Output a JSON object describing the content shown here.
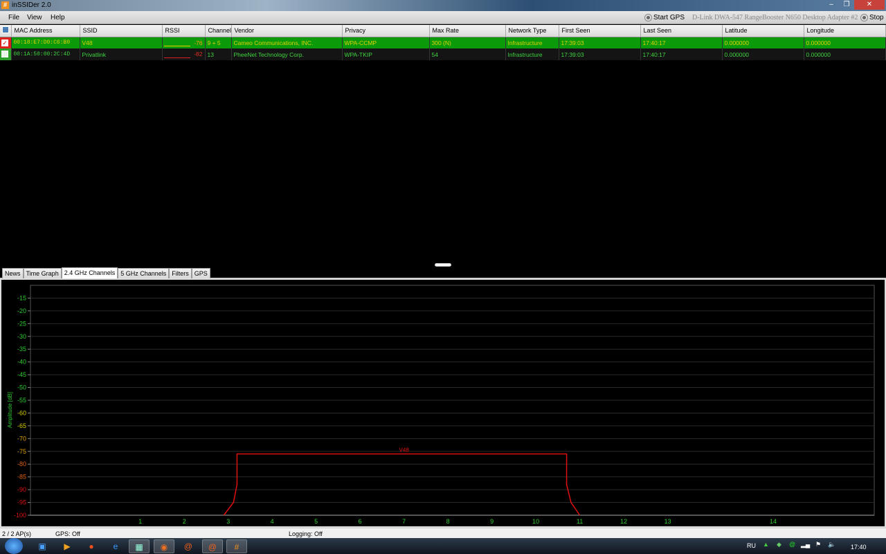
{
  "window": {
    "title": "inSSIDer 2.0",
    "app_icon": "#"
  },
  "menu": {
    "items": [
      "File",
      "View",
      "Help"
    ],
    "start_gps": "Start GPS",
    "adapter": "D-Link DWA-547 RangeBooster N650 Desktop Adapter #2",
    "stop": "Stop"
  },
  "table": {
    "columns": [
      "MAC Address",
      "SSID",
      "RSSI",
      "Channel",
      "Vendor",
      "Privacy",
      "Max Rate",
      "Network Type",
      "First Seen",
      "Last Seen",
      "Latitude",
      "Longitude"
    ],
    "rows": [
      {
        "checked": true,
        "mac": "00:18:E7:D0:C6:B0",
        "ssid": "V48",
        "rssi": "-76",
        "channel": "9 + 5",
        "vendor": "Cameo Communications, INC.",
        "privacy": "WPA-CCMP",
        "max_rate": "300 (N)",
        "network_type": "Infrastructure",
        "first_seen": "17:39:03",
        "last_seen": "17:40:17",
        "latitude": "0.000000",
        "longitude": "0.000000"
      },
      {
        "checked": false,
        "mac": "00:1A:50:00:2C:4D",
        "ssid": "Privatlink",
        "rssi": "-82",
        "channel": "13",
        "vendor": "PheeNet Technology Corp.",
        "privacy": "WPA-TKIP",
        "max_rate": "54",
        "network_type": "Infrastructure",
        "first_seen": "17:39:03",
        "last_seen": "17:40:17",
        "latitude": "0.000000",
        "longitude": "0.000000"
      }
    ]
  },
  "tabs": [
    "News",
    "Time Graph",
    "2.4 GHz Channels",
    "5 GHz Channels",
    "Filters",
    "GPS"
  ],
  "active_tab": "2.4 GHz Channels",
  "chart_data": {
    "type": "line",
    "title": "",
    "xlabel": "",
    "ylabel": "Amplitude [dB]",
    "xlim_mhz": [
      2399.5,
      2495.5
    ],
    "ylim": [
      -10,
      -100
    ],
    "x_ticks": [
      {
        "label": "1",
        "mhz": 2412
      },
      {
        "label": "2",
        "mhz": 2417
      },
      {
        "label": "3",
        "mhz": 2422
      },
      {
        "label": "4",
        "mhz": 2427
      },
      {
        "label": "5",
        "mhz": 2432
      },
      {
        "label": "6",
        "mhz": 2437
      },
      {
        "label": "7",
        "mhz": 2442
      },
      {
        "label": "8",
        "mhz": 2447
      },
      {
        "label": "9",
        "mhz": 2452
      },
      {
        "label": "10",
        "mhz": 2457
      },
      {
        "label": "11",
        "mhz": 2462
      },
      {
        "label": "12",
        "mhz": 2467
      },
      {
        "label": "13",
        "mhz": 2472
      },
      {
        "label": "14",
        "mhz": 2484
      }
    ],
    "y_ticks": [
      -15,
      -20,
      -25,
      -30,
      -35,
      -40,
      -45,
      -50,
      -55,
      -60,
      -65,
      -70,
      -75,
      -80,
      -85,
      -90,
      -95,
      -100
    ],
    "grid": true,
    "series": [
      {
        "name": "V48",
        "color": "#e01010",
        "points": [
          [
            2421.5,
            -100
          ],
          [
            2422.6,
            -95
          ],
          [
            2423,
            -88
          ],
          [
            2423,
            -76
          ],
          [
            2460.5,
            -76
          ],
          [
            2460.5,
            -88
          ],
          [
            2461,
            -95
          ],
          [
            2462,
            -100
          ]
        ],
        "label_at": [
          2442,
          -76
        ]
      }
    ]
  },
  "status": {
    "aps": "2 / 2 AP(s)",
    "gps": "GPS: Off",
    "logging": "Logging: Off"
  },
  "tray": {
    "lang": "RU",
    "clock": "17:40"
  }
}
